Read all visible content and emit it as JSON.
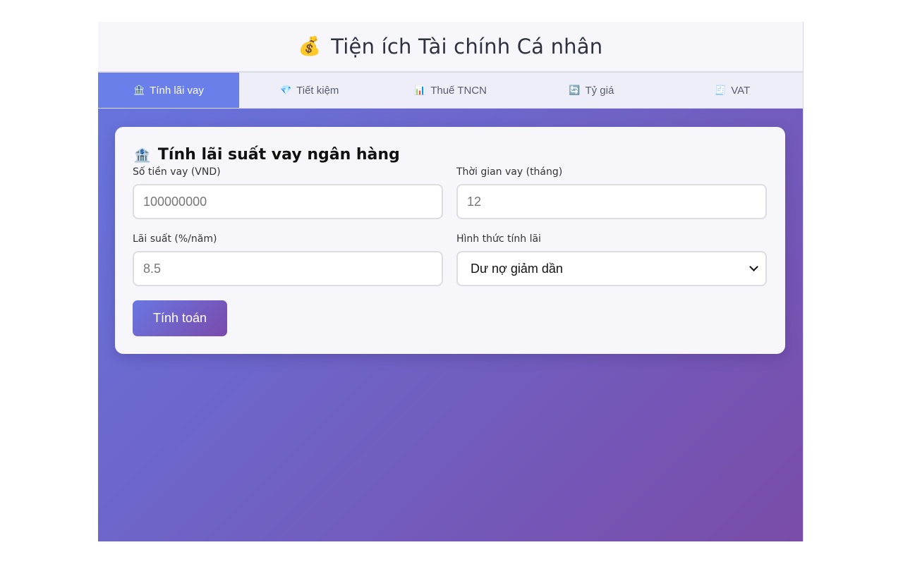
{
  "header": {
    "icon": "money-bag-icon",
    "emoji": "💰",
    "title": "Tiện ích Tài chính Cá nhân"
  },
  "tabs": [
    {
      "emoji": "🏦",
      "icon": "bank-icon",
      "label": "Tính lãi vay",
      "active": true
    },
    {
      "emoji": "💎",
      "icon": "gem-icon",
      "label": "Tiết kiệm",
      "active": false
    },
    {
      "emoji": "📊",
      "icon": "bar-chart-icon",
      "label": "Thuế TNCN",
      "active": false
    },
    {
      "emoji": "🔄",
      "icon": "exchange-icon",
      "label": "Tỷ giá",
      "active": false
    },
    {
      "emoji": "🧾",
      "icon": "receipt-icon",
      "label": "VAT",
      "active": false
    }
  ],
  "card": {
    "emoji": "🏦",
    "icon": "bank-icon",
    "title": "Tính lãi suất vay ngân hàng",
    "fields": {
      "amount": {
        "label": "Số tiền vay (VND)",
        "placeholder": "100000000"
      },
      "term": {
        "label": "Thời gian vay (tháng)",
        "placeholder": "12"
      },
      "rate": {
        "label": "Lãi suất (%/năm)",
        "placeholder": "8.5"
      },
      "method": {
        "label": "Hình thức tính lãi",
        "selected": "Dư nợ giảm dần"
      }
    },
    "button": "Tính toán"
  },
  "colors": {
    "accent": "#6a7fea",
    "gradient_start": "#6677e0",
    "gradient_end": "#7a4ca8"
  }
}
